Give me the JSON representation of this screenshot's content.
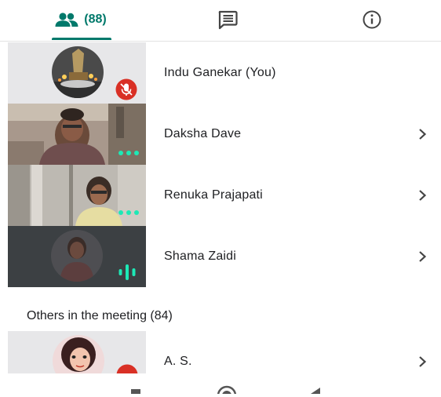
{
  "tabs": {
    "people_count": "(88)",
    "active": "people"
  },
  "colors": {
    "accent": "#00796b",
    "muted_badge": "#d93025",
    "speaking_indicator": "#1de9b6"
  },
  "participants": [
    {
      "name": "Indu Ganekar (You)",
      "tile": "avatar-photo",
      "status_icon": "mic-off-icon",
      "chevron": false
    },
    {
      "name": "Daksha Dave",
      "tile": "video",
      "status_icon": "three-dots-icon",
      "chevron": true
    },
    {
      "name": "Renuka Prajapati",
      "tile": "video",
      "status_icon": "three-dots-icon",
      "chevron": true
    },
    {
      "name": "Shama Zaidi",
      "tile": "avatar-photo",
      "status_icon": "speaking-bars-icon",
      "chevron": true
    }
  ],
  "others": {
    "header": "Others in the meeting (84)",
    "items": [
      {
        "name": "A. S.",
        "tile": "avatar-photo",
        "status_icon": "mic-off-icon",
        "chevron": true
      }
    ]
  },
  "nav_icons": [
    "recent-apps-icon",
    "home-icon",
    "back-icon"
  ]
}
